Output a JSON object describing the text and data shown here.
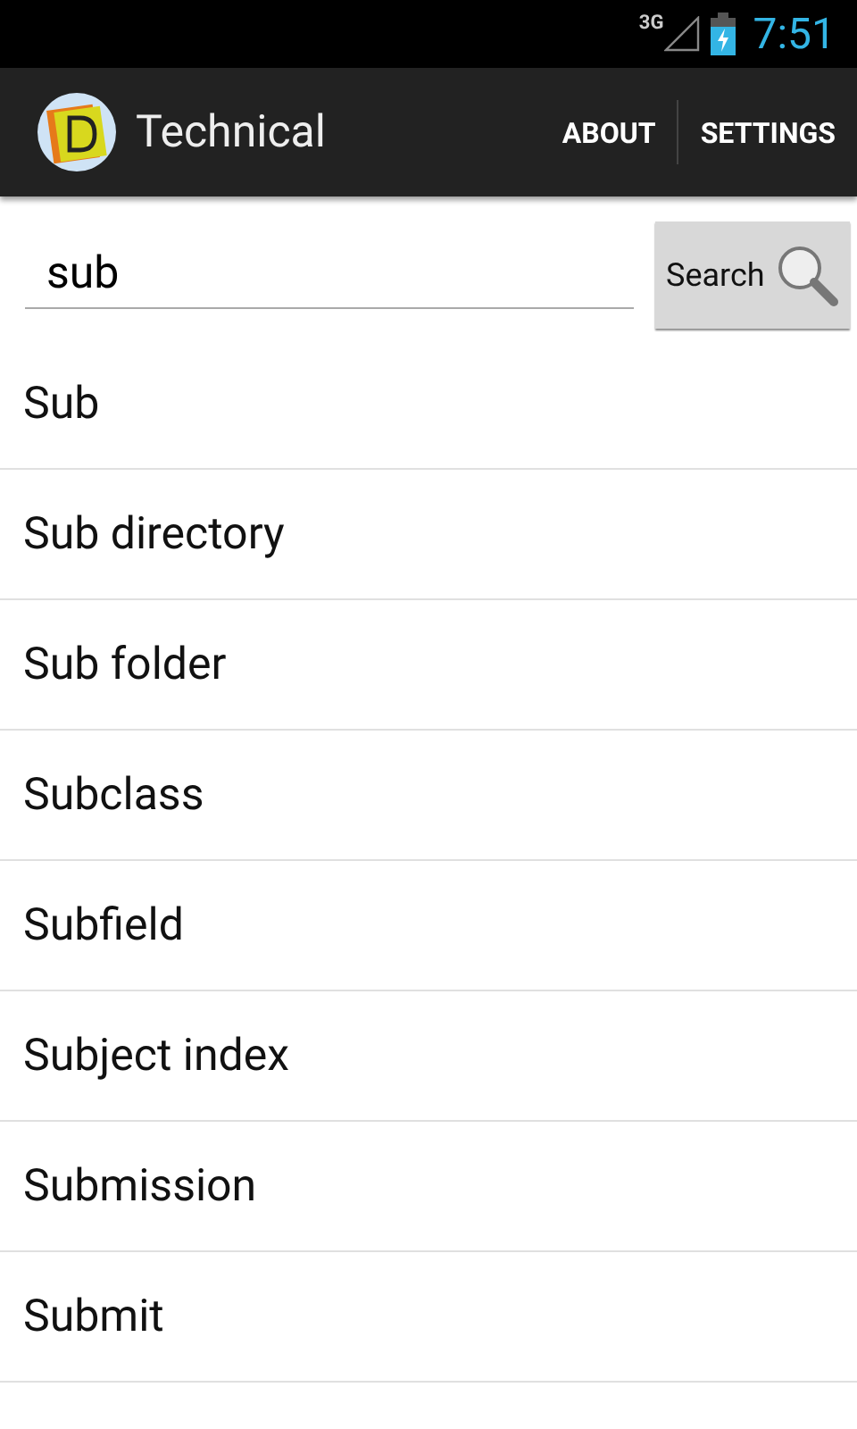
{
  "status_bar": {
    "network": "3G",
    "time": "7:51"
  },
  "action_bar": {
    "title": "Technical",
    "actions": [
      "ABOUT",
      "SETTINGS"
    ]
  },
  "search": {
    "value": "sub",
    "button": "Search"
  },
  "results": [
    "Sub",
    "Sub directory",
    "Sub folder",
    "Subclass",
    "Subfield",
    "Subject index",
    "Submission",
    "Submit"
  ]
}
